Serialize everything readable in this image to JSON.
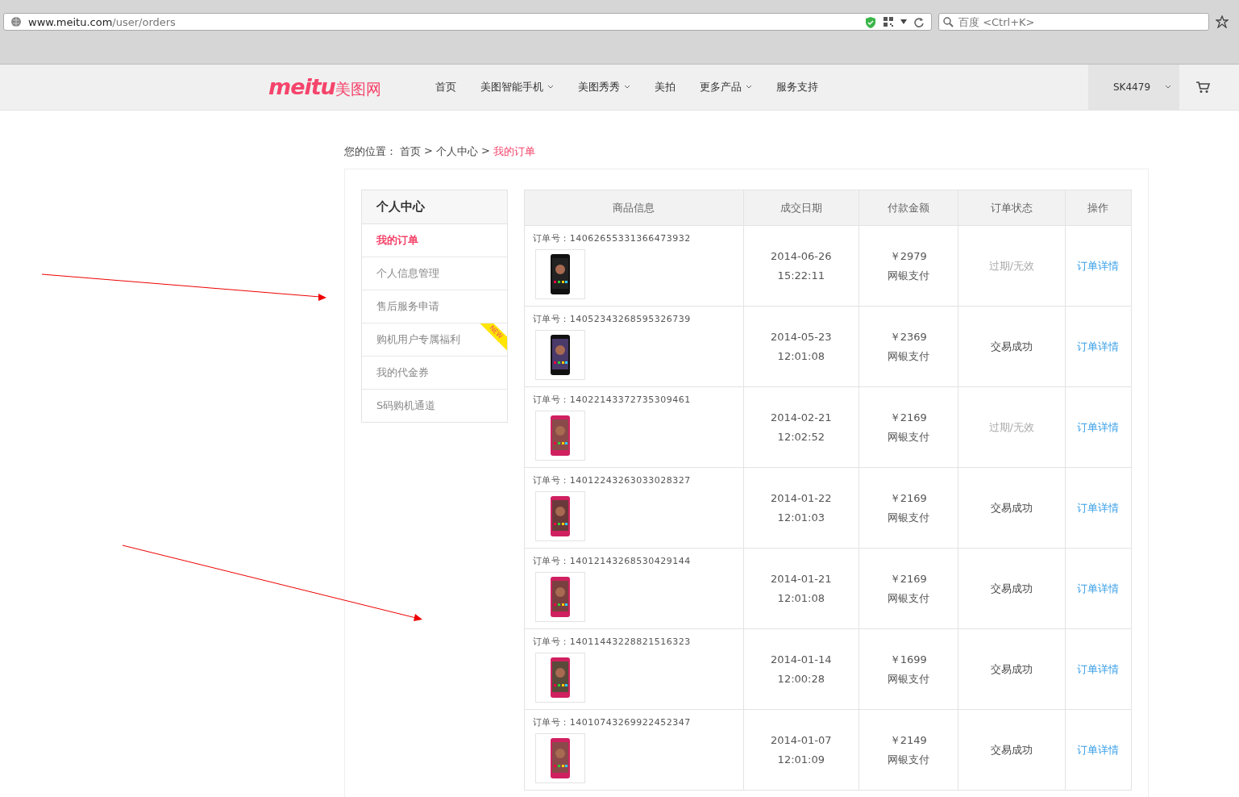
{
  "browser": {
    "url_host": "www.meitu.com",
    "url_path": "/user/orders",
    "search_placeholder": "百度 <Ctrl+K>"
  },
  "nav": {
    "logo_word": "meitu",
    "logo_cn": "美图网",
    "items": [
      {
        "label": "首页",
        "dropdown": false
      },
      {
        "label": "美图智能手机",
        "dropdown": true
      },
      {
        "label": "美图秀秀",
        "dropdown": true
      },
      {
        "label": "美拍",
        "dropdown": false
      },
      {
        "label": "更多产品",
        "dropdown": true
      },
      {
        "label": "服务支持",
        "dropdown": false
      }
    ],
    "user": "SK4479"
  },
  "breadcrumb": {
    "prefix": "您的位置：",
    "items": [
      {
        "label": "首页",
        "current": false
      },
      {
        "label": "个人中心",
        "current": false
      },
      {
        "label": "我的订单",
        "current": true
      }
    ],
    "separator": ">"
  },
  "sidebar": {
    "title": "个人中心",
    "items": [
      {
        "label": "我的订单",
        "selected": true
      },
      {
        "label": "个人信息管理",
        "selected": false
      },
      {
        "label": "售后服务申请",
        "selected": false
      },
      {
        "label": "购机用户专属福利",
        "selected": false,
        "badge": "NEW"
      },
      {
        "label": "我的代金券",
        "selected": false
      },
      {
        "label": "S码购机通道",
        "selected": false
      }
    ]
  },
  "table": {
    "columns": [
      "商品信息",
      "成交日期",
      "付款金额",
      "订单状态",
      "操作"
    ],
    "rows": [
      {
        "order_label": "订单号：",
        "order_no": "14062655331366473932",
        "date": "2014-06-26",
        "time": "15:22:11",
        "amount": "￥2979",
        "payment": "网银支付",
        "status": "过期/无效",
        "kind": "expired",
        "action": "订单详情"
      },
      {
        "order_label": "订单号：",
        "order_no": "14052343268595326739",
        "date": "2014-05-23",
        "time": "12:01:08",
        "amount": "￥2369",
        "payment": "网银支付",
        "status": "交易成功",
        "kind": "success",
        "action": "订单详情"
      },
      {
        "order_label": "订单号：",
        "order_no": "14022143372735309461",
        "date": "2014-02-21",
        "time": "12:02:52",
        "amount": "￥2169",
        "payment": "网银支付",
        "status": "过期/无效",
        "kind": "expired",
        "action": "订单详情"
      },
      {
        "order_label": "订单号：",
        "order_no": "14012243263033028327",
        "date": "2014-01-22",
        "time": "12:01:03",
        "amount": "￥2169",
        "payment": "网银支付",
        "status": "交易成功",
        "kind": "success",
        "action": "订单详情"
      },
      {
        "order_label": "订单号：",
        "order_no": "14012143268530429144",
        "date": "2014-01-21",
        "time": "12:01:08",
        "amount": "￥2169",
        "payment": "网银支付",
        "status": "交易成功",
        "kind": "success",
        "action": "订单详情"
      },
      {
        "order_label": "订单号：",
        "order_no": "14011443228821516323",
        "date": "2014-01-14",
        "time": "12:00:28",
        "amount": "￥1699",
        "payment": "网银支付",
        "status": "交易成功",
        "kind": "success",
        "action": "订单详情"
      },
      {
        "order_label": "订单号：",
        "order_no": "14010743269922452347",
        "date": "2014-01-07",
        "time": "12:01:09",
        "amount": "￥2149",
        "payment": "网银支付",
        "status": "交易成功",
        "kind": "success",
        "action": "订单详情"
      }
    ]
  }
}
